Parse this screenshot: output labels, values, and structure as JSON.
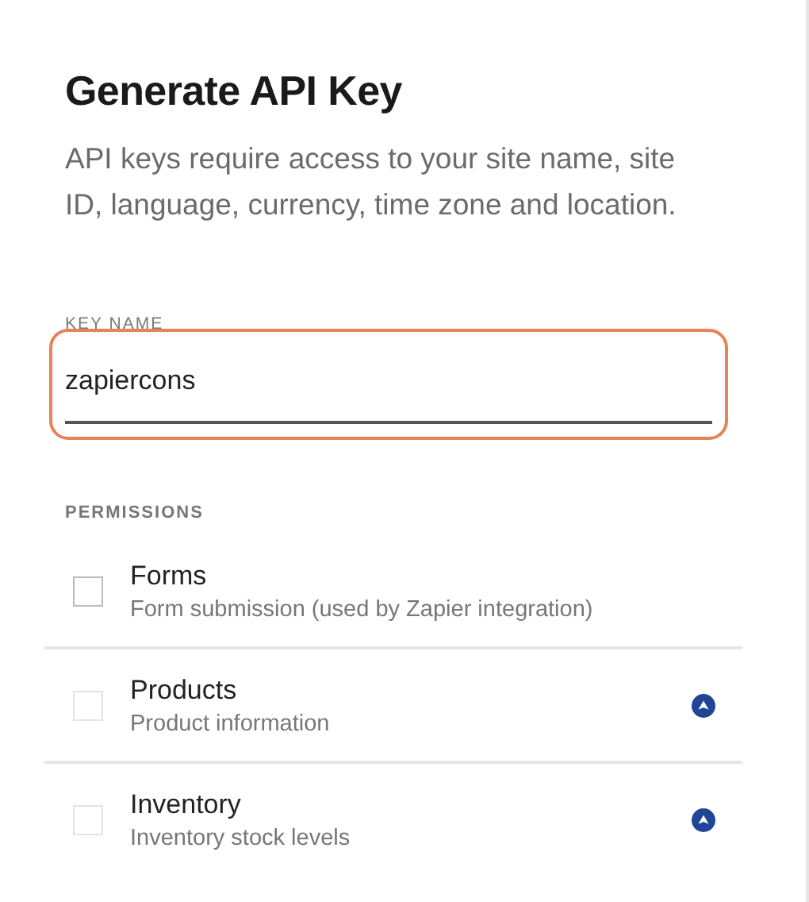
{
  "title": "Generate API Key",
  "description": "API keys require access to your site name, site ID, language, currency, time zone and location.",
  "key_name": {
    "label": "KEY NAME",
    "value": "zapiercons",
    "focused": true
  },
  "permissions": {
    "label": "PERMISSIONS",
    "items": [
      {
        "name": "Forms",
        "description": "Form submission (used by Zapier integration)",
        "checked": false,
        "disabled": false,
        "badge": false
      },
      {
        "name": "Products",
        "description": "Product information",
        "checked": false,
        "disabled": true,
        "badge": true
      },
      {
        "name": "Inventory",
        "description": "Inventory stock levels",
        "checked": false,
        "disabled": true,
        "badge": true
      }
    ]
  }
}
